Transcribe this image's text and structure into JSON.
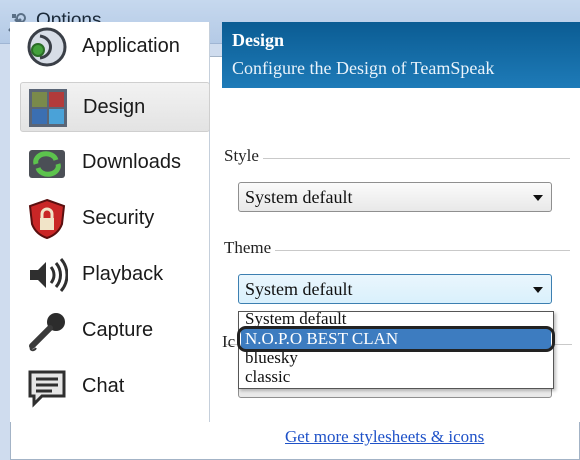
{
  "window": {
    "title": "Options",
    "icon": "tools-icon"
  },
  "sidebar": {
    "items": [
      {
        "label": "Application",
        "icon": "application-icon",
        "selected": false
      },
      {
        "label": "Design",
        "icon": "design-icon",
        "selected": true
      },
      {
        "label": "Downloads",
        "icon": "downloads-icon",
        "selected": false
      },
      {
        "label": "Security",
        "icon": "security-icon",
        "selected": false
      },
      {
        "label": "Playback",
        "icon": "playback-icon",
        "selected": false
      },
      {
        "label": "Capture",
        "icon": "capture-icon",
        "selected": false
      },
      {
        "label": "Chat",
        "icon": "chat-icon",
        "selected": false
      }
    ]
  },
  "content": {
    "title": "Design",
    "subtitle": "Configure the Design of TeamSpeak",
    "style": {
      "label": "Style",
      "value": "System default"
    },
    "theme": {
      "label": "Theme",
      "value": "System default",
      "options": [
        "System default",
        "N.O.P.O BEST CLAN",
        "bluesky",
        "classic"
      ],
      "highlighted": "N.O.P.O BEST CLAN"
    },
    "icons_label_fragment": "Ic",
    "link": "Get more stylesheets & icons"
  },
  "colors": {
    "header": "#1466a3",
    "highlight": "#3d7cc0",
    "link": "#1f52c8"
  }
}
